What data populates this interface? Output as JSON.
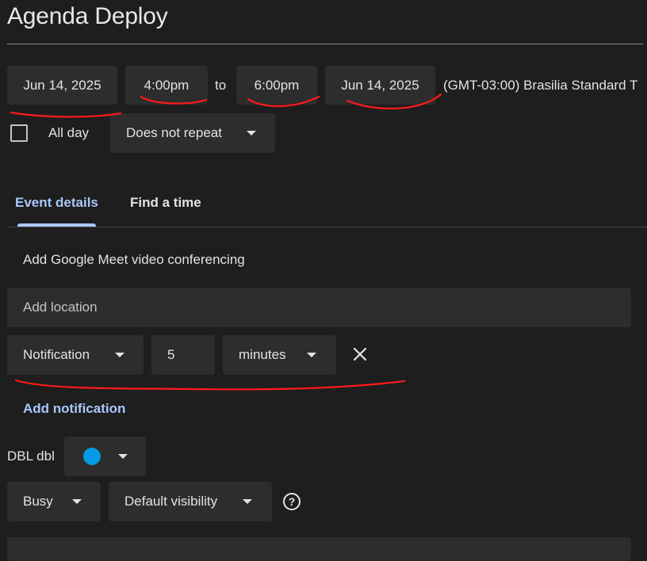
{
  "title": "Agenda Deploy",
  "datetime": {
    "start_date": "Jun 14, 2025",
    "start_time": "4:00pm",
    "to_label": "to",
    "end_time": "6:00pm",
    "end_date": "Jun 14, 2025",
    "timezone": "(GMT-03:00) Brasilia Standard T"
  },
  "all_day_label": "All day",
  "repeat_value": "Does not repeat",
  "tabs": [
    {
      "label": "Event details",
      "active": true
    },
    {
      "label": "Find a time",
      "active": false
    }
  ],
  "meet_label": "Add Google Meet video conferencing",
  "location_placeholder": "Add location",
  "notification": {
    "type": "Notification",
    "value": "5",
    "unit": "minutes"
  },
  "add_notification_label": "Add notification",
  "calendar": {
    "label": "DBL dbl",
    "color": "#039be5"
  },
  "status_value": "Busy",
  "visibility_value": "Default visibility",
  "accent_color": "#a8c7fa",
  "annotation_color": "#ff0000"
}
